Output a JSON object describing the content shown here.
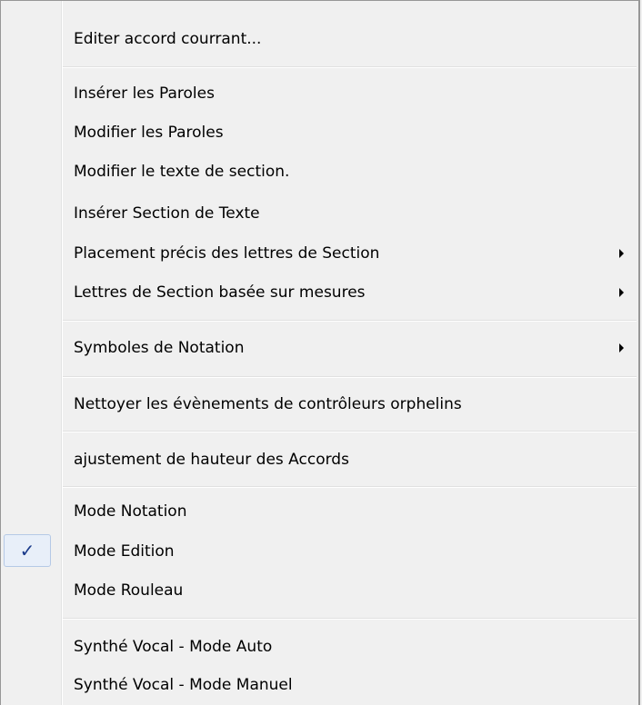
{
  "menu": {
    "items": [
      {
        "label": "Editer accord courrant...",
        "submenu": false
      },
      {
        "label": "Insérer les Paroles",
        "submenu": false
      },
      {
        "label": "Modifier les Paroles",
        "submenu": false
      },
      {
        "label": "Modifier le texte de section.",
        "submenu": false
      },
      {
        "label": "Insérer Section de Texte",
        "submenu": false
      },
      {
        "label": "Placement précis des lettres de Section",
        "submenu": true
      },
      {
        "label": "Lettres de Section basée sur mesures",
        "submenu": true
      },
      {
        "label": "Symboles de Notation",
        "submenu": true
      },
      {
        "label": "Nettoyer les évènements de contrôleurs orphelins",
        "submenu": false
      },
      {
        "label": "ajustement de hauteur des Accords",
        "submenu": false
      },
      {
        "label": "Mode Notation",
        "submenu": false
      },
      {
        "label": "Mode Edition",
        "submenu": false,
        "checked": true
      },
      {
        "label": "Mode Rouleau",
        "submenu": false
      },
      {
        "label": "Synthé Vocal - Mode Auto",
        "submenu": false
      },
      {
        "label": "Synthé Vocal - Mode Manuel",
        "submenu": false
      }
    ],
    "check_glyph": "✓",
    "submenu_icon": "chevron-right-icon",
    "colors": {
      "background": "#f0f0f0",
      "border": "#979797",
      "checkmark": "#1a3a8a",
      "check_highlight": "#e8eff9"
    }
  }
}
